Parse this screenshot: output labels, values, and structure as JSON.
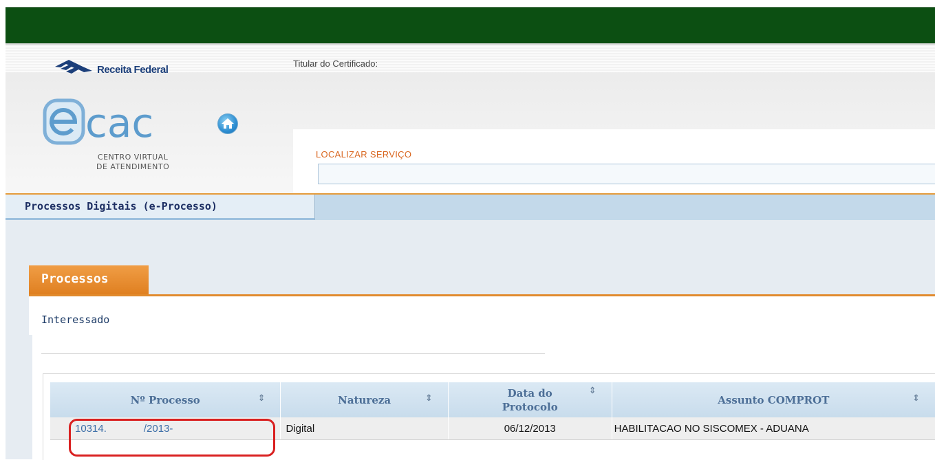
{
  "header": {
    "brand": "Receita Federal",
    "logo": {
      "main": "cac",
      "sub_line1": "CENTRO VIRTUAL",
      "sub_line2": "DE ATENDIMENTO"
    },
    "titular_label": "Titular do Certificado:",
    "home_icon": "home-icon"
  },
  "search": {
    "label": "LOCALIZAR SERVIÇO",
    "value": ""
  },
  "nav": {
    "active_tab": "Processos Digitais (e-Processo)"
  },
  "processos": {
    "tab_label": "Processos",
    "interessado_label": "Interessado",
    "table": {
      "columns": [
        "Nº Processo",
        "Natureza",
        "Data do Protocolo",
        "Assunto COMPROT"
      ],
      "rows": [
        {
          "processo_part1": "10314.",
          "processo_part2": "/2013-",
          "natureza": "Digital",
          "data": "06/12/2013",
          "assunto": "HABILITACAO NO SISCOMEX - ADUANA"
        }
      ]
    }
  },
  "colors": {
    "topbar": "#0c4f12",
    "accent_orange": "#e18a2d",
    "highlight": "#d92020"
  }
}
